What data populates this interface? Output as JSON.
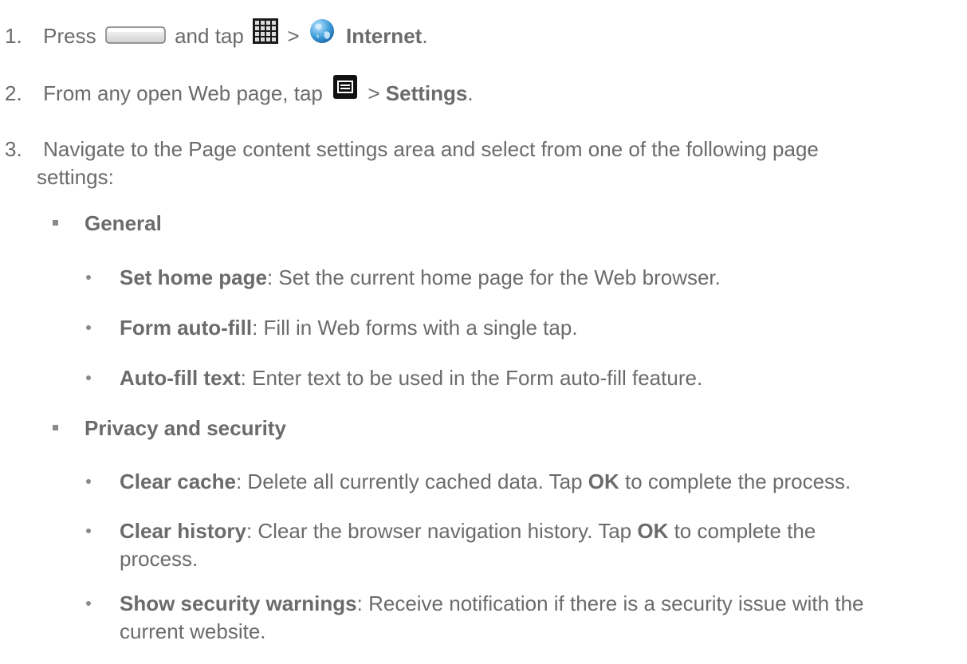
{
  "steps": [
    {
      "number": "1.",
      "parts": {
        "press": "Press",
        "and_tap": "and tap",
        "sep1": ">",
        "app": "Internet",
        "end": "."
      },
      "icons": [
        "home-button-icon",
        "apps-grid-icon",
        "internet-globe-icon"
      ]
    },
    {
      "number": "2.",
      "parts": {
        "lead": "From any open Web page, tap",
        "sep": ">",
        "target": "Settings",
        "end": "."
      },
      "icons": [
        "menu-key-icon"
      ]
    },
    {
      "number": "3.",
      "line1": "Navigate to the Page content settings area and select from one of the following page",
      "line2": "settings:"
    }
  ],
  "groups": [
    {
      "title": "General",
      "items": [
        {
          "label": "Set home page",
          "desc": ": Set the current home page for the Web browser."
        },
        {
          "label": "Form auto-fill",
          "desc": ": Fill in Web forms with a single tap."
        },
        {
          "label": "Auto-fill text",
          "desc": ": Enter text to be used in the Form auto-fill feature."
        }
      ]
    },
    {
      "title": "Privacy and security",
      "items": [
        {
          "label": "Clear cache",
          "desc_a": ": Delete all currently cached data. Tap ",
          "ok": "OK",
          "desc_b": " to complete the process."
        },
        {
          "label": "Clear history",
          "desc_a": ": Clear the browser navigation history. Tap ",
          "ok": "OK",
          "desc_b": " to complete the",
          "desc_c": "process."
        },
        {
          "label": "Show security warnings",
          "desc_a": ": Receive notification if there is a security issue with the",
          "desc_c": "current website."
        }
      ]
    }
  ],
  "colors": {
    "text": "#6b6b6b",
    "bullet": "#8a8a8a"
  }
}
